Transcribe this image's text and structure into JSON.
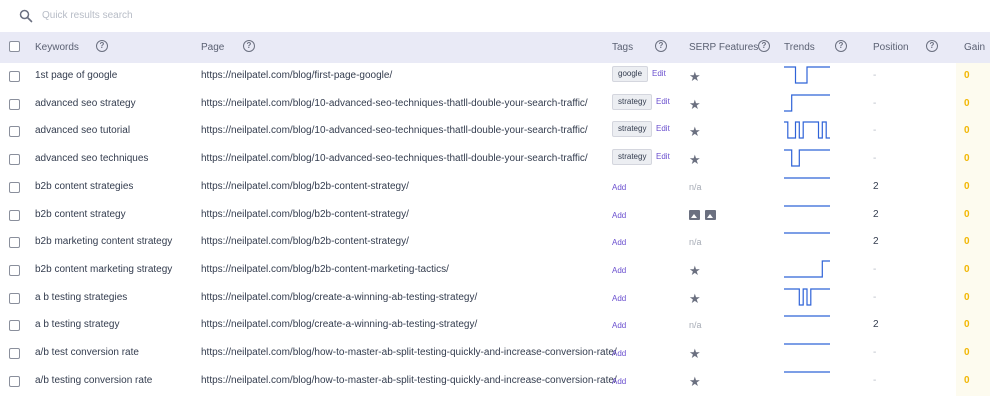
{
  "search": {
    "placeholder": "Quick results search"
  },
  "columns": {
    "keywords": "Keywords",
    "page": "Page",
    "tags": "Tags",
    "serp": "SERP Features",
    "trends": "Trends",
    "position": "Position",
    "gain": "Gain"
  },
  "labels": {
    "edit": "Edit",
    "add": "Add",
    "na": "n/a"
  },
  "colors": {
    "accent": "#6a4fcf",
    "gain": "#f2b705",
    "trend": "#2f63d8",
    "header_bg": "#e9eaf6"
  },
  "rows": [
    {
      "keyword": "1st page of google",
      "url": "https://neilpatel.com/blog/first-page-google/",
      "tag": "google",
      "serp": "star",
      "position": "-",
      "gain": "0",
      "trend": [
        1,
        1,
        1,
        0,
        0,
        0,
        1,
        1,
        1,
        1,
        1,
        1
      ]
    },
    {
      "keyword": "advanced seo strategy",
      "url": "https://neilpatel.com/blog/10-advanced-seo-techniques-thatll-double-your-search-traffic/",
      "tag": "strategy",
      "serp": "star",
      "position": "-",
      "gain": "0",
      "trend": [
        0,
        0,
        1,
        1,
        1,
        1,
        1,
        1,
        1,
        1,
        1,
        1
      ]
    },
    {
      "keyword": "advanced seo tutorial",
      "url": "https://neilpatel.com/blog/10-advanced-seo-techniques-thatll-double-your-search-traffic/",
      "tag": "strategy",
      "serp": "star",
      "position": "-",
      "gain": "0",
      "trend": [
        1,
        0,
        0,
        1,
        0,
        1,
        1,
        1,
        1,
        0,
        1,
        0
      ]
    },
    {
      "keyword": "advanced seo techniques",
      "url": "https://neilpatel.com/blog/10-advanced-seo-techniques-thatll-double-your-search-traffic/",
      "tag": "strategy",
      "serp": "star",
      "position": "-",
      "gain": "0",
      "trend": [
        1,
        1,
        0,
        0,
        1,
        1,
        1,
        1,
        1,
        1,
        1,
        1
      ]
    },
    {
      "keyword": "b2b content strategies",
      "url": "https://neilpatel.com/blog/b2b-content-strategy/",
      "tag": "",
      "serp": "na",
      "position": "2",
      "gain": "0",
      "trend": [
        1,
        1,
        1,
        1,
        1,
        1,
        1,
        1,
        1,
        1,
        1,
        1
      ]
    },
    {
      "keyword": "b2b content strategy",
      "url": "https://neilpatel.com/blog/b2b-content-strategy/",
      "tag": "",
      "serp": "images",
      "position": "2",
      "gain": "0",
      "trend": [
        1,
        1,
        1,
        1,
        1,
        1,
        1,
        1,
        1,
        1,
        1,
        1
      ]
    },
    {
      "keyword": "b2b marketing content strategy",
      "url": "https://neilpatel.com/blog/b2b-content-strategy/",
      "tag": "",
      "serp": "na",
      "position": "2",
      "gain": "0",
      "trend": [
        1,
        1,
        1,
        1,
        1,
        1,
        1,
        1,
        1,
        1,
        1,
        1
      ]
    },
    {
      "keyword": "b2b content marketing strategy",
      "url": "https://neilpatel.com/blog/b2b-content-marketing-tactics/",
      "tag": "",
      "serp": "star",
      "position": "-",
      "gain": "0",
      "trend": [
        0,
        0,
        0,
        0,
        0,
        0,
        0,
        0,
        0,
        0,
        1,
        1
      ]
    },
    {
      "keyword": "a b testing strategies",
      "url": "https://neilpatel.com/blog/create-a-winning-ab-testing-strategy/",
      "tag": "",
      "serp": "star",
      "position": "-",
      "gain": "0",
      "trend": [
        1,
        1,
        1,
        1,
        0,
        1,
        0,
        1,
        1,
        1,
        1,
        1
      ]
    },
    {
      "keyword": "a b testing strategy",
      "url": "https://neilpatel.com/blog/create-a-winning-ab-testing-strategy/",
      "tag": "",
      "serp": "na",
      "position": "2",
      "gain": "0",
      "trend": [
        1,
        1,
        1,
        1,
        1,
        1,
        1,
        1,
        1,
        1,
        1,
        1
      ]
    },
    {
      "keyword": "a/b test conversion rate",
      "url": "https://neilpatel.com/blog/how-to-master-ab-split-testing-quickly-and-increase-conversion-rate/",
      "tag": "",
      "serp": "star",
      "position": "-",
      "gain": "0",
      "trend": [
        1,
        1,
        1,
        1,
        1,
        1,
        1,
        1,
        1,
        1,
        1,
        1
      ]
    },
    {
      "keyword": "a/b testing conversion rate",
      "url": "https://neilpatel.com/blog/how-to-master-ab-split-testing-quickly-and-increase-conversion-rate/",
      "tag": "",
      "serp": "star",
      "position": "-",
      "gain": "0",
      "trend": [
        1,
        1,
        1,
        1,
        1,
        1,
        1,
        1,
        1,
        1,
        1,
        1
      ]
    }
  ]
}
